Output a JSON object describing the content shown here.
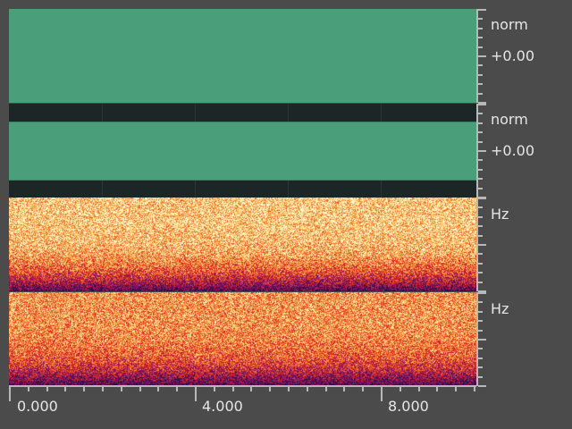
{
  "layers": [
    {
      "type": "waveform",
      "unit": "norm",
      "value": "+0.00"
    },
    {
      "type": "waveform",
      "unit": "norm",
      "value": "+0.00"
    },
    {
      "type": "spectrogram",
      "unit": "Hz"
    },
    {
      "type": "spectrogram",
      "unit": "Hz"
    }
  ],
  "time_axis": {
    "labels": [
      "0.000",
      "4.000",
      "8.000"
    ]
  },
  "colors": {
    "waveform": "#4a9e7a",
    "background": "#4b4b4b"
  }
}
